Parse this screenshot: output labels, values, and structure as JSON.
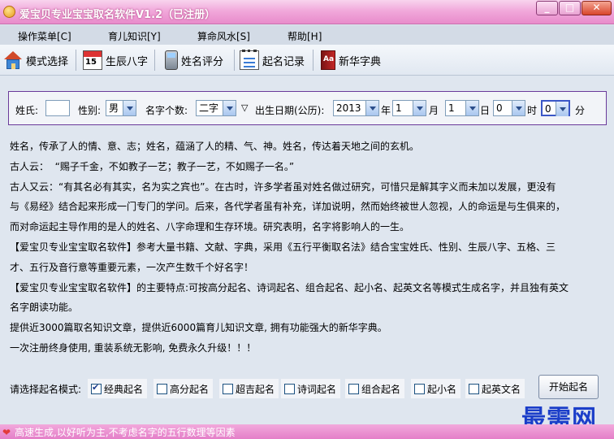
{
  "window": {
    "title": "爱宝贝专业宝宝取名软件V1.2（已注册）",
    "min": "_",
    "max": "□",
    "close": "✕"
  },
  "menu": [
    "操作菜单[C]",
    "育儿知识[Y]",
    "算命风水[S]",
    "帮助[H]"
  ],
  "toolbar": [
    {
      "label": "模式选择",
      "icon": "house-icon"
    },
    {
      "label": "生辰八字",
      "icon": "calendar-icon",
      "num": "15"
    },
    {
      "label": "姓名评分",
      "icon": "phone-icon"
    },
    {
      "label": "起名记录",
      "icon": "notebook-icon"
    },
    {
      "label": "新华字典",
      "icon": "dictionary-icon",
      "abbr": "Aa"
    }
  ],
  "form": {
    "surname_label": "姓氏:",
    "surname_value": "",
    "gender_label": "性别:",
    "gender_value": "男",
    "count_label": "名字个数:",
    "count_value": "二字",
    "dob_label": "出生日期(公历):",
    "year": "2013",
    "year_unit": "年",
    "month": "1",
    "month_unit": "月",
    "day": "1",
    "day_unit": "日",
    "hour": "0",
    "hour_unit": "时",
    "minute": "0",
    "minute_unit": "分",
    "triangle": "▽"
  },
  "description": [
    "姓名，传承了人的情、意、志；姓名，蕴涵了人的精、气、神。姓名，传达着天地之间的玄机。",
    "古人云：  “赐子千金，不如教子一艺；教子一艺，不如赐子一名。”",
    "古人又云：“有其名必有其实，名为实之宾也”。在古时，许多学者虽对姓名做过研究，可惜只是解其字义而未加以发展，更没有",
    "与《易经》结合起来形成一门专门的学问。后来，各代学者虽有补充，详加说明，然而始终被世人忽视，人的命运是与生俱来的，",
    "而对命运起主导作用的是人的姓名、八字命理和生存环境。研究表明，名字将影响人的一生。",
    "【爱宝贝专业宝宝取名软件】参考大量书籍、文献、字典，采用《五行平衡取名法》结合宝宝姓氏、性别、生辰八字、五格、三",
    "才、五行及音行意等重要元素，一次产生数千个好名字！",
    "【爱宝贝专业宝宝取名软件】的主要特点:可按高分起名、诗词起名、组合起名、起小名、起英文名等模式生成名字，并且独有英文",
    "名字朗读功能。",
    "提供近3000篇取名知识文章，提供近6000篇育儿知识文章, 拥有功能强大的新华字典。",
    "一次注册终身使用, 重装系统无影响, 免费永久升级！！！"
  ],
  "modes": {
    "label": "请选择起名模式:",
    "options": [
      {
        "label": "经典起名",
        "checked": true
      },
      {
        "label": "高分起名",
        "checked": false
      },
      {
        "label": "超吉起名",
        "checked": false
      },
      {
        "label": "诗词起名",
        "checked": false
      },
      {
        "label": "组合起名",
        "checked": false
      },
      {
        "label": "起小名",
        "checked": false
      },
      {
        "label": "起英文名",
        "checked": false
      }
    ],
    "start_button": "开始起名"
  },
  "watermark": "最需网",
  "status": "高速生成,以好听为主,不考虑名字的五行数理等因素"
}
